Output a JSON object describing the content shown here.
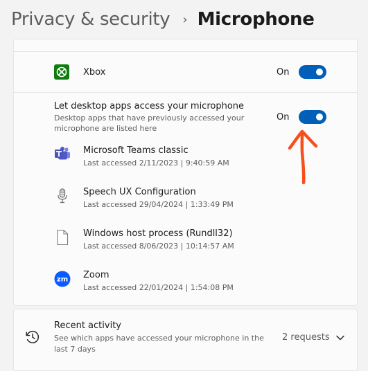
{
  "breadcrumb": {
    "parent": "Privacy & security",
    "separator": "›",
    "current": "Microphone"
  },
  "xbox": {
    "label": "Xbox",
    "status": "On",
    "toggle_on": true,
    "icon": "xbox-icon"
  },
  "desktop_apps": {
    "title": "Let desktop apps access your microphone",
    "description_line1": "Desktop apps that have previously accessed your",
    "description_line2": "microphone are listed here",
    "status": "On",
    "toggle_on": true,
    "apps": [
      {
        "name": "Microsoft Teams classic",
        "last_accessed": "Last accessed 2/11/2023  |  9:40:59 AM",
        "icon": "teams-icon"
      },
      {
        "name": "Speech UX Configuration",
        "last_accessed": "Last accessed 29/04/2024  |  1:33:49 PM",
        "icon": "microphone-icon"
      },
      {
        "name": "Windows host process (Rundll32)",
        "last_accessed": "Last accessed 8/06/2023  |  10:14:57 AM",
        "icon": "file-icon"
      },
      {
        "name": "Zoom",
        "last_accessed": "Last accessed 22/01/2024  |  1:54:08 PM",
        "icon": "zoom-icon"
      }
    ]
  },
  "recent_activity": {
    "title": "Recent activity",
    "description_line1": "See which apps have accessed your microphone in the",
    "description_line2": "last 7 days",
    "requests": "2 requests",
    "icon": "history-icon"
  },
  "colors": {
    "accent": "#005fb8",
    "annotation": "#f4511e",
    "xbox": "#107c10",
    "teams": "#5059c9",
    "zoom": "#0b5cff"
  }
}
